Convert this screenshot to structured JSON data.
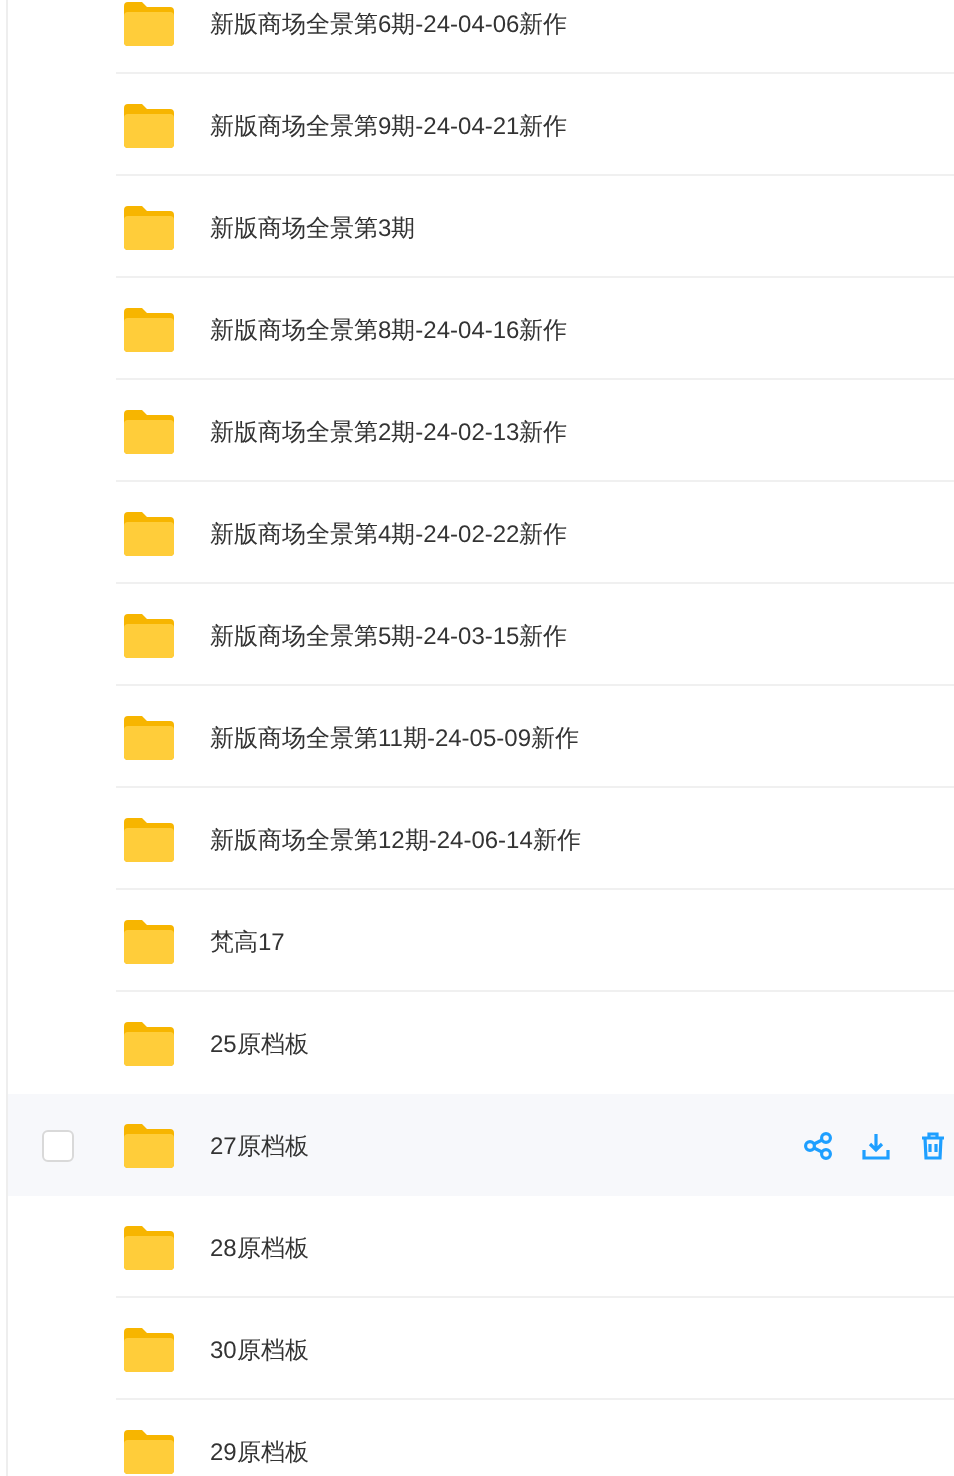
{
  "files": [
    {
      "name": "新版商场全景第6期-24-04-06新作",
      "hovered": false
    },
    {
      "name": "新版商场全景第9期-24-04-21新作",
      "hovered": false
    },
    {
      "name": "新版商场全景第3期",
      "hovered": false
    },
    {
      "name": "新版商场全景第8期-24-04-16新作",
      "hovered": false
    },
    {
      "name": "新版商场全景第2期-24-02-13新作",
      "hovered": false
    },
    {
      "name": "新版商场全景第4期-24-02-22新作",
      "hovered": false
    },
    {
      "name": "新版商场全景第5期-24-03-15新作",
      "hovered": false
    },
    {
      "name": "新版商场全景第11期-24-05-09新作",
      "hovered": false
    },
    {
      "name": "新版商场全景第12期-24-06-14新作",
      "hovered": false
    },
    {
      "name": "梵高17",
      "hovered": false
    },
    {
      "name": "25原档板",
      "hovered": false
    },
    {
      "name": "27原档板",
      "hovered": true
    },
    {
      "name": "28原档板",
      "hovered": false
    },
    {
      "name": "30原档板",
      "hovered": false
    },
    {
      "name": "29原档板",
      "hovered": false
    }
  ]
}
